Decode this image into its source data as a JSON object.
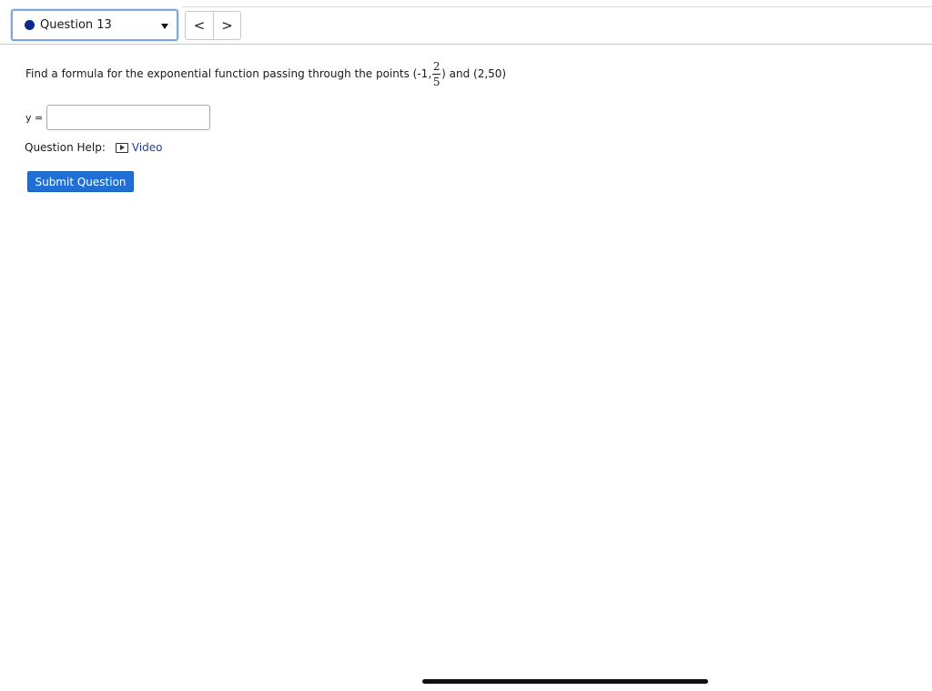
{
  "header": {
    "question_select": {
      "label": "Question 13",
      "status_color": "#0b2a8a"
    },
    "nav": {
      "prev_label": "<",
      "next_label": ">"
    }
  },
  "question": {
    "text": "Find a formula for the exponential function passing through the points (-1,",
    "fraction_numerator": "2",
    "fraction_denominator": "5",
    "text_after": ") and (2,50)"
  },
  "answer": {
    "label": "y =",
    "value": ""
  },
  "help": {
    "label": "Question Help:",
    "video_label": "Video",
    "link_color": "#1f3f9f"
  },
  "submit": {
    "label": "Submit Question",
    "color": "#1f6fd6"
  }
}
